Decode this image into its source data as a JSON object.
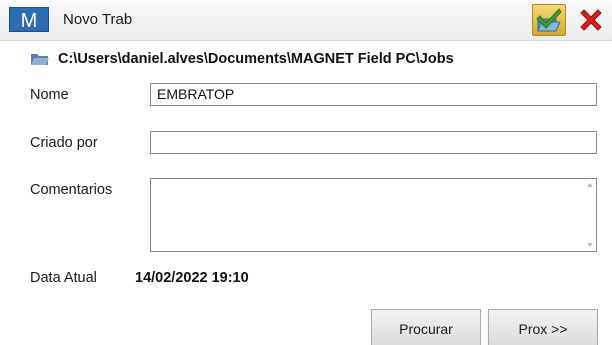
{
  "titlebar": {
    "logo_letter": "M",
    "title": "Novo Trab",
    "ok_icon": "check-folder-icon",
    "close_icon": "close-icon"
  },
  "path": {
    "icon": "folder-icon",
    "text": "C:\\Users\\daniel.alves\\Documents\\MAGNET Field PC\\Jobs"
  },
  "form": {
    "nome_label": "Nome",
    "nome_value": "EMBRATOP",
    "criado_label": "Criado por",
    "criado_value": "",
    "comentarios_label": "Comentarios",
    "comentarios_value": "",
    "data_label": "Data Atual",
    "data_value": "14/02/2022 19:10"
  },
  "buttons": {
    "procurar": "Procurar",
    "prox": "Prox >>"
  },
  "colors": {
    "brand": "#2b6db3",
    "ok": "#d9a928",
    "check": "#3aa02a",
    "close": "#d42020"
  }
}
